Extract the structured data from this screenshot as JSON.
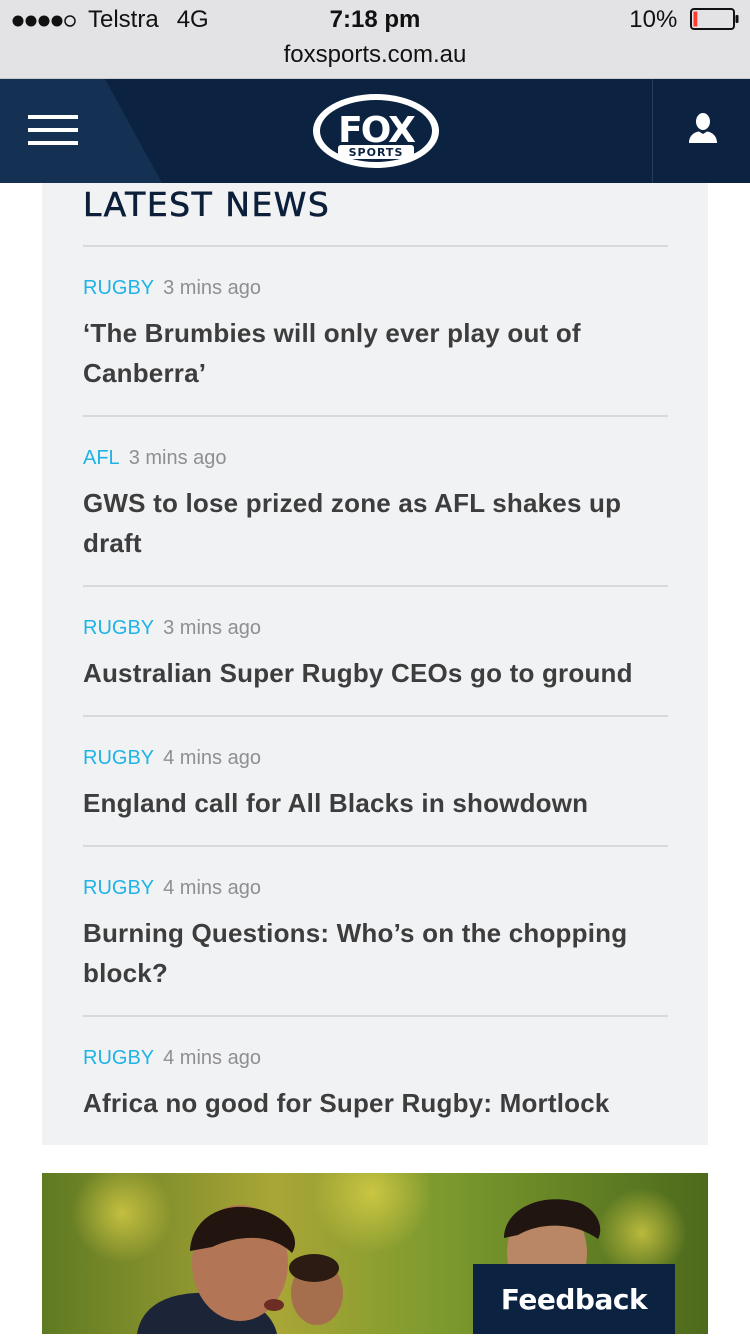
{
  "status_bar": {
    "signal_text": "●●●●○",
    "carrier": "Telstra",
    "network": "4G",
    "time": "7:18 pm",
    "battery_percent": "10%",
    "battery_level": 0.1,
    "battery_color": "#ff3b30"
  },
  "browser": {
    "url": "foxsports.com.au"
  },
  "header": {
    "logo_main": "FOX",
    "logo_sub": "SPORTS",
    "menu_icon": "hamburger-menu-icon",
    "account_icon": "user-silhouette-icon",
    "background_color": "#0b2240"
  },
  "news": {
    "heading": "LATEST NEWS",
    "accent_color": "#1fb3e6",
    "items": [
      {
        "category": "RUGBY",
        "time": "3 mins ago",
        "title": "‘The Brumbies will only ever play out of Canberra’"
      },
      {
        "category": "AFL",
        "time": "3 mins ago",
        "title": "GWS to lose prized zone as AFL shakes up draft"
      },
      {
        "category": "RUGBY",
        "time": "3 mins ago",
        "title": "Australian Super Rugby CEOs go to ground"
      },
      {
        "category": "RUGBY",
        "time": "4 mins ago",
        "title": "England call for All Blacks in showdown"
      },
      {
        "category": "RUGBY",
        "time": "4 mins ago",
        "title": "Burning Questions: Who’s on the chopping block?"
      },
      {
        "category": "RUGBY",
        "time": "4 mins ago",
        "title": "Africa no good for Super Rugby: Mortlock"
      }
    ]
  },
  "feedback": {
    "label": "Feedback"
  }
}
